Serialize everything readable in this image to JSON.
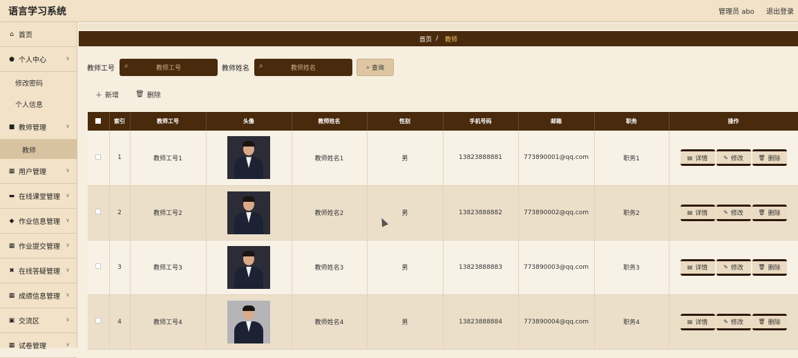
{
  "app": {
    "title": "语言学习系统",
    "user": "管理员 abo",
    "logout": "退出登录"
  },
  "sidebar": {
    "items": [
      {
        "label": "首页",
        "icon": "home-icon",
        "glyph": "⌂",
        "chevron": false
      },
      {
        "label": "个人中心",
        "icon": "user-icon",
        "glyph": "●",
        "chevron": true
      },
      {
        "label": "修改密码",
        "sub": true
      },
      {
        "label": "个人信息",
        "sub": true
      },
      {
        "label": "教师管理",
        "icon": "briefcase-icon",
        "glyph": "■",
        "chevron": true
      },
      {
        "label": "教师",
        "sub": true,
        "active": true
      },
      {
        "label": "用户管理",
        "icon": "grid-icon",
        "glyph": "▦",
        "chevron": true
      },
      {
        "label": "在线课堂管理",
        "icon": "message-icon",
        "glyph": "▬",
        "chevron": true
      },
      {
        "label": "作业信息管理",
        "icon": "pin-icon",
        "glyph": "◆",
        "chevron": true
      },
      {
        "label": "作业提交管理",
        "icon": "grid-icon",
        "glyph": "▦",
        "chevron": true
      },
      {
        "label": "在线答疑管理",
        "icon": "question-icon",
        "glyph": "✖",
        "chevron": true
      },
      {
        "label": "成绩信息管理",
        "icon": "grid-icon",
        "glyph": "▦",
        "chevron": true
      },
      {
        "label": "交流区",
        "icon": "chat-icon",
        "glyph": "▣",
        "chevron": true
      },
      {
        "label": "试卷管理",
        "icon": "grid-icon",
        "glyph": "▦",
        "chevron": true
      }
    ]
  },
  "breadcrumb": {
    "home": "首页",
    "sep": "/",
    "current": "教师"
  },
  "search": {
    "id_label": "教师工号",
    "id_placeholder": "教师工号",
    "name_label": "教师姓名",
    "name_placeholder": "教师姓名",
    "button": "查询"
  },
  "actions": {
    "add": "新增",
    "delete": "删除"
  },
  "table": {
    "headers": [
      "",
      "索引",
      "教师工号",
      "头像",
      "教师姓名",
      "性别",
      "手机号码",
      "邮箱",
      "职务",
      "操作"
    ],
    "buttons": {
      "detail": "详情",
      "edit": "修改",
      "delete": "删除"
    },
    "rows": [
      {
        "index": "1",
        "id": "教师工号1",
        "name": "教师姓名1",
        "gender": "男",
        "phone": "13823888881",
        "email": "773890001@qq.com",
        "position": "职务1"
      },
      {
        "index": "2",
        "id": "教师工号2",
        "name": "教师姓名2",
        "gender": "男",
        "phone": "13823888882",
        "email": "773890002@qq.com",
        "position": "职务2"
      },
      {
        "index": "3",
        "id": "教师工号3",
        "name": "教师姓名3",
        "gender": "男",
        "phone": "13823888883",
        "email": "773890003@qq.com",
        "position": "职务3"
      },
      {
        "index": "4",
        "id": "教师工号4",
        "name": "教师姓名4",
        "gender": "男",
        "phone": "13823888884",
        "email": "773890004@qq.com",
        "position": "职务4"
      }
    ]
  }
}
